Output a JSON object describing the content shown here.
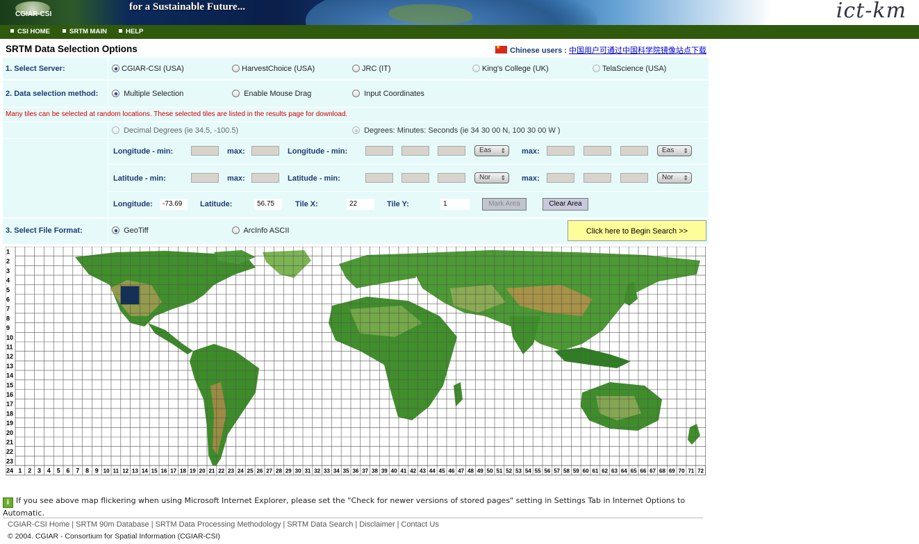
{
  "header": {
    "logo_text": "CGIAR-CSI",
    "tagline": "for a Sustainable Future...",
    "brand_right": "ict-km"
  },
  "nav": {
    "items": [
      "CSI HOME",
      "SRTM MAIN",
      "HELP"
    ]
  },
  "page_title": "SRTM Data Selection Options",
  "chinese_notice": {
    "label": "Chinese users :",
    "link": "中国用户可通过中国科学院镜像站点下载"
  },
  "server": {
    "label": "1. Select Server:",
    "options": [
      "CGIAR-CSI (USA)",
      "HarvestChoice (USA)",
      "JRC (IT)",
      "King's College (UK)",
      "TelaScience (USA)"
    ],
    "selected": "CGIAR-CSI (USA)"
  },
  "method": {
    "label": "2. Data selection method:",
    "options": [
      "Multiple Selection",
      "Enable Mouse Drag",
      "Input Coordinates"
    ],
    "selected": "Multiple Selection",
    "message": "Many tiles can be selected at random locations. These selected tiles are listed in the results page for download."
  },
  "coords": {
    "decimal_label": "Decimal Degrees (ie 34.5, -100.5)",
    "dms_label": "Degrees: Minutes: Seconds (ie 34 30 00 N, 100 30 00 W )",
    "lon_min": "Longitude - min:",
    "lat_min": "Latitude - min:",
    "max": "max:",
    "east": "Eas",
    "north": "Nor"
  },
  "readout": {
    "longitude_label": "Longitude:",
    "longitude": "-73.69",
    "latitude_label": "Latitude:",
    "latitude": "56.75",
    "tilex_label": "Tile X:",
    "tilex": "22",
    "tiley_label": "Tile Y:",
    "tiley": "1",
    "mark_area": "Mark Area",
    "clear_area": "Clear Area"
  },
  "format": {
    "label": "3. Select File Format:",
    "options": [
      "GeoTiff",
      "ArcInfo ASCII"
    ],
    "selected": "GeoTiff",
    "search_button": "Click here to Begin Search >>"
  },
  "map": {
    "columns": 72,
    "rows": 24,
    "selected_tile": {
      "x": 12,
      "y": 5
    },
    "selected_color": "#143055"
  },
  "info_text": "If you see above map flickering when using Microsoft Internet Explorer, please set the \"Check for newer versions of stored pages\" setting in Settings Tab in Internet Options to Automatic.",
  "footer": {
    "links": [
      "CGIAR-CSI Home",
      "SRTM 90m Database",
      "SRTM Data Processing Methodology",
      "SRTM Data Search",
      "Disclaimer",
      "Contact Us"
    ],
    "copyright": "© 2004. CGIAR - Consortium for Spatial Information (CGIAR-CSI)"
  }
}
